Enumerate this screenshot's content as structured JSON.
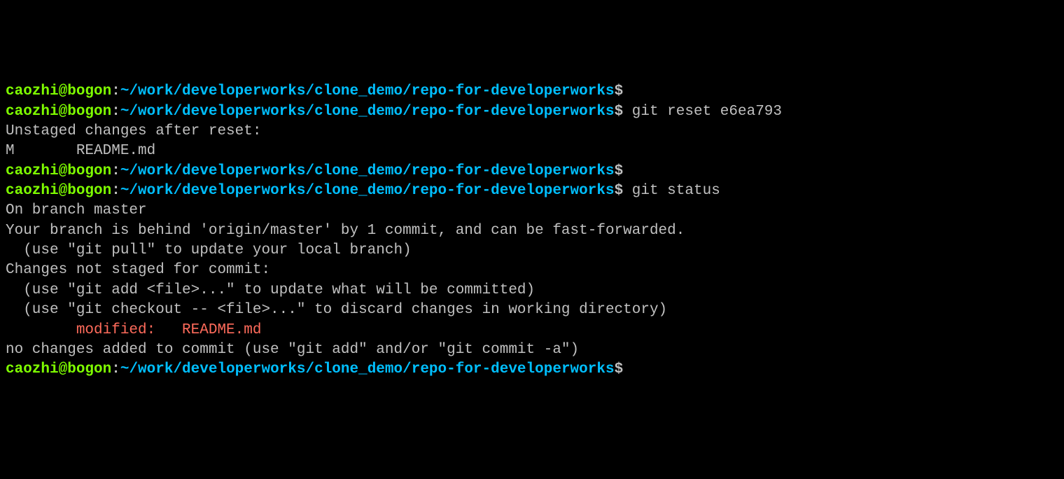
{
  "prompt": {
    "user": "caozhi@bogon",
    "sep": ":",
    "path": "~/work/developerworks/clone_demo/repo-for-developerworks",
    "dollar": "$"
  },
  "lines": {
    "cmd1": "",
    "cmd2": " git reset e6ea793",
    "out1": "Unstaged changes after reset:",
    "out2": "M       README.md",
    "cmd3": "",
    "cmd4": " git status",
    "out3": "On branch master",
    "out4": "Your branch is behind 'origin/master' by 1 commit, and can be fast-forwarded.",
    "out5": "  (use \"git pull\" to update your local branch)",
    "out6": "",
    "out7": "Changes not staged for commit:",
    "out8": "  (use \"git add <file>...\" to update what will be committed)",
    "out9": "  (use \"git checkout -- <file>...\" to discard changes in working directory)",
    "out10": "",
    "modified": "        modified:   README.md",
    "out11": "",
    "out12": "no changes added to commit (use \"git add\" and/or \"git commit -a\")",
    "cmd5": ""
  }
}
